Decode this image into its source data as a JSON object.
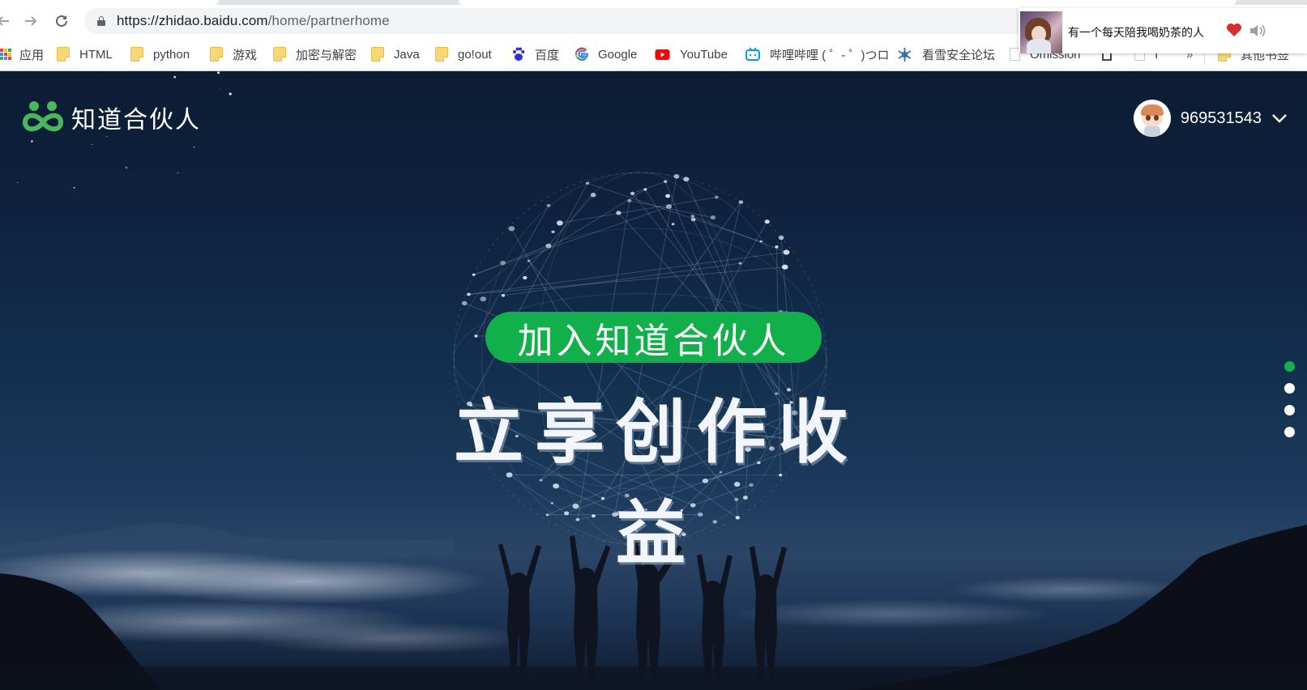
{
  "browser": {
    "url": {
      "host": "https://zhidao.baidu.com",
      "path": "/home/partnerhome"
    },
    "nav": {
      "back_icon": "arrow-left-icon",
      "forward_icon": "arrow-right-icon",
      "reload_icon": "reload-icon"
    },
    "bookmarks": [
      {
        "label": "应用",
        "icon": "apps-grid-icon"
      },
      {
        "label": "HTML",
        "icon": "folder-icon"
      },
      {
        "label": "python",
        "icon": "folder-icon"
      },
      {
        "label": "游戏",
        "icon": "folder-icon"
      },
      {
        "label": "加密与解密",
        "icon": "folder-icon"
      },
      {
        "label": "Java",
        "icon": "folder-icon"
      },
      {
        "label": "go!out",
        "icon": "folder-icon"
      },
      {
        "label": "百度",
        "icon": "baidu-paw-icon"
      },
      {
        "label": "Google",
        "icon": "google-g-icon"
      },
      {
        "label": "YouTube",
        "icon": "youtube-icon"
      },
      {
        "label": "哔哩哔哩 ( ゜- ゜)つロ",
        "icon": "bilibili-tv-icon"
      },
      {
        "label": "看雪安全论坛",
        "icon": "snowflake-icon"
      },
      {
        "label": "Omission",
        "icon": "page-icon"
      },
      {
        "label": "",
        "icon": "page-icon"
      },
      {
        "label": "I",
        "icon": "page-icon"
      },
      {
        "label": "»",
        "icon": ""
      },
      {
        "label": "其他书签",
        "icon": "folder-icon"
      }
    ]
  },
  "music_popup": {
    "song_title": "有一个每天陪我喝奶茶的人",
    "like_icon": "heart-icon",
    "volume_icon": "speaker-icon"
  },
  "page": {
    "logo_text": "知道合伙人",
    "user": {
      "name": "969531543",
      "dropdown_icon": "chevron-down-icon"
    },
    "cta_button": "加入知道合伙人",
    "headline": "立享创作收益",
    "slide_indicator": {
      "count": 4,
      "active_index": 0
    }
  },
  "colors": {
    "brand_green": "#12b04a",
    "sky_top": "#0c1c33",
    "sky_mid": "#1c3a5c"
  }
}
